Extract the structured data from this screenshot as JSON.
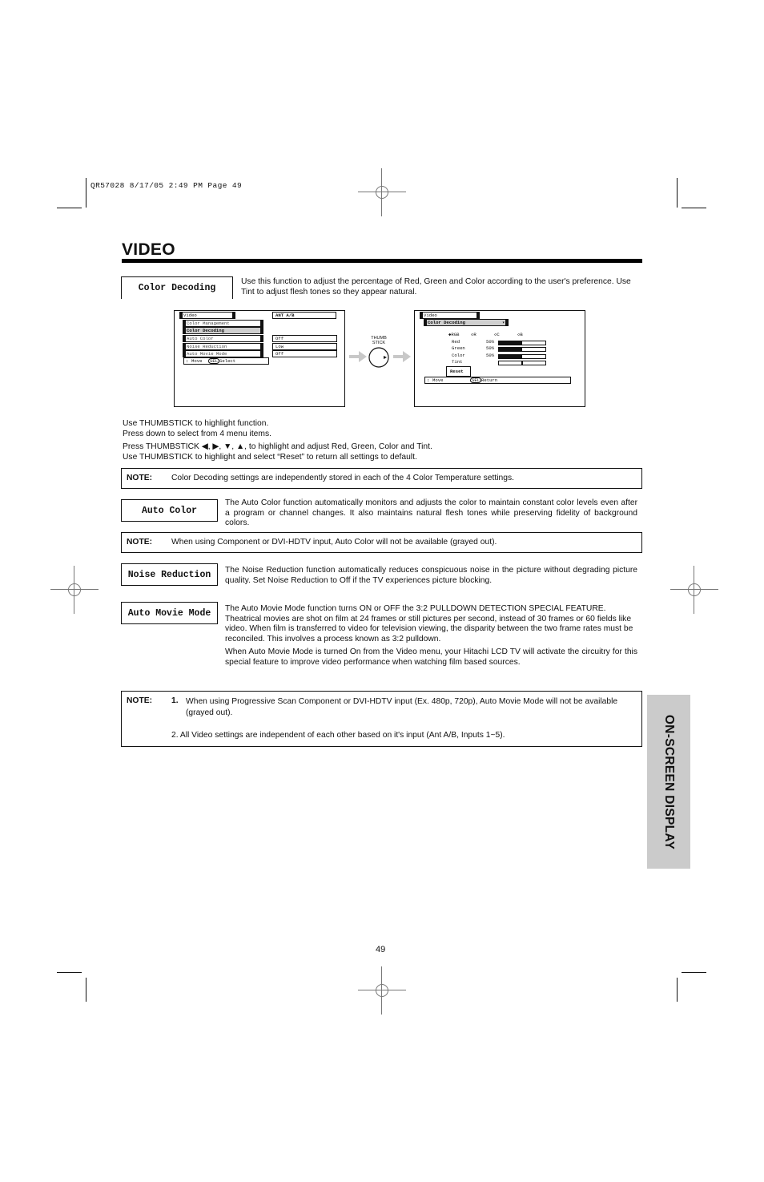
{
  "slug": "QR57028  8/17/05  2:49 PM  Page 49",
  "page_title": "VIDEO",
  "side_tab": "ON-SCREEN DISPLAY",
  "page_number": "49",
  "sections": {
    "color_decoding": {
      "label": "Color Decoding",
      "description": "Use this function to adjust the percentage of Red, Green and Color according to the user's preference. Use Tint to adjust flesh tones so they appear natural."
    },
    "auto_color": {
      "label": "Auto Color",
      "description": "The Auto Color function automatically monitors and adjusts the color to maintain constant color levels even after a program or channel changes. It also maintains natural flesh tones while preserving fidelity of background colors."
    },
    "noise_reduction": {
      "label": "Noise Reduction",
      "description": "The Noise Reduction function automatically reduces conspicuous noise in the picture without degrading picture quality.  Set Noise Reduction to Off if the TV experiences picture blocking."
    },
    "auto_movie_mode": {
      "label": "Auto Movie Mode",
      "description_1": "The Auto Movie Mode function turns ON or OFF the 3:2 PULLDOWN DETECTION SPECIAL FEATURE. Theatrical movies are shot on film at 24 frames or still pictures per second, instead of 30 frames or 60 fields like video.  When film is transferred to video for television viewing, the disparity between the two frame rates must be reconciled.  This involves a process known as 3:2 pulldown.",
      "description_2": "When Auto Movie Mode is turned On from the Video menu, your Hitachi LCD TV will activate the circuitry for this special feature to improve video performance when watching film based sources."
    }
  },
  "instructions": [
    "Use THUMBSTICK to highlight function.",
    "Press down to select from 4 menu items.",
    "Press THUMBSTICK ◀, ▶, ▼, ▲, to highlight and adjust Red, Green, Color and Tint.",
    "Use THUMBSTICK to highlight and select “Reset” to return all settings to default."
  ],
  "notes": {
    "label": "NOTE:",
    "color_decoding": "Color Decoding settings are independently stored in each of the 4 Color Temperature settings.",
    "auto_color": "When using Component or DVI-HDTV input, Auto Color will not be available (grayed out).",
    "final_1_num": "1.",
    "final_1": "When using Progressive Scan Component or DVI-HDTV input (Ex. 480p, 720p), Auto Movie Mode will not be available (grayed out).",
    "final_2": "2.  All Video settings are independent of each other based on it's input (Ant A/B, Inputs 1~5)."
  },
  "osd_left": {
    "title": "Video",
    "input": "ANT A/B",
    "items": [
      {
        "label": "Color Management",
        "value": ""
      },
      {
        "label": "Color Decoding",
        "value": ""
      },
      {
        "label": "Auto Color",
        "value": "Off"
      },
      {
        "label": "Noise Reduction",
        "value": "Low"
      },
      {
        "label": "Auto Movie Mode",
        "value": "Off"
      }
    ],
    "hint_move": "Move",
    "hint_sel": "SEL",
    "hint_select": "Select"
  },
  "thumbstick_label": "THUMB STICK",
  "osd_right": {
    "title": "Video",
    "submenu": "Color Decoding",
    "modes": [
      "RGB",
      "R",
      "C",
      "B"
    ],
    "selected_mode": "RGB",
    "sliders": [
      {
        "label": "Red",
        "value_text": "50%",
        "value": 0.5
      },
      {
        "label": "Green",
        "value_text": "50%",
        "value": 0.5
      },
      {
        "label": "Color",
        "value_text": "50%",
        "value": 0.5
      },
      {
        "label": "Tint",
        "value_text": "",
        "value": 0.5
      }
    ],
    "reset": "Reset",
    "hint_move": "Move",
    "hint_sel": "SEL",
    "hint_return": "Return"
  }
}
